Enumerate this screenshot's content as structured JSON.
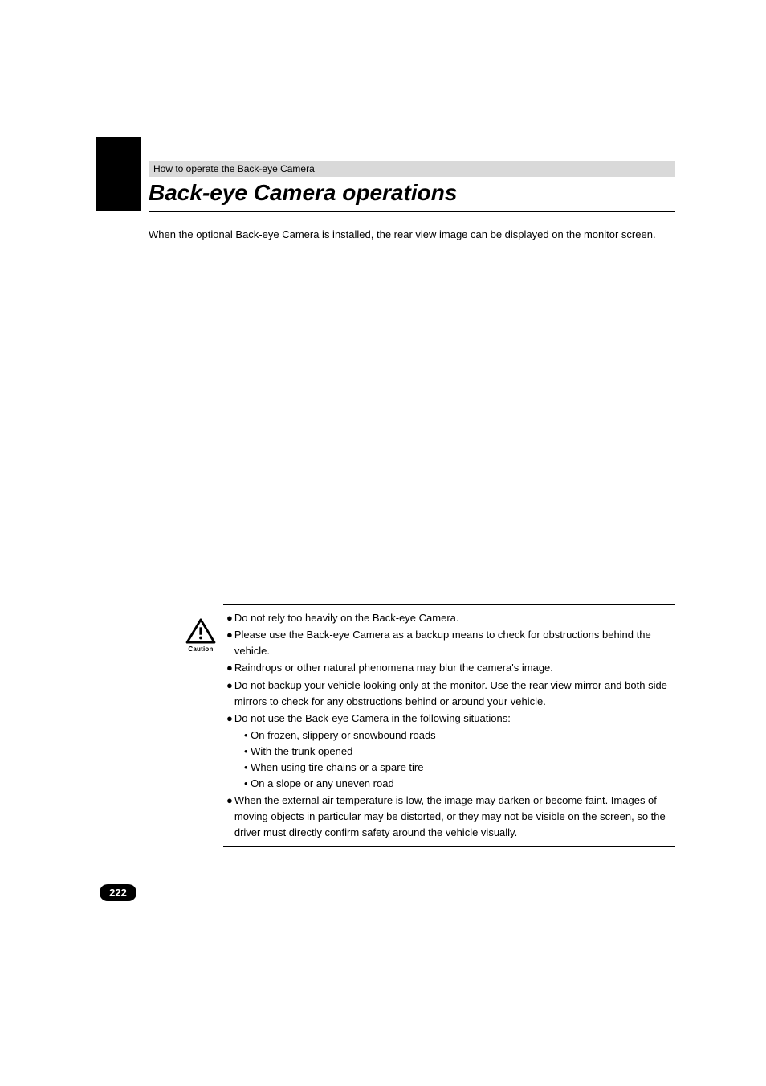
{
  "header": {
    "section_label": "How to operate the Back-eye Camera",
    "title": "Back-eye Camera operations"
  },
  "intro": "When the optional Back-eye Camera is installed, the rear view image can be displayed on the monitor screen.",
  "caution": {
    "label": "Caution",
    "items": [
      {
        "text": "Do not rely too heavily on the Back-eye Camera."
      },
      {
        "text": "Please use the Back-eye Camera as a backup means to check for obstructions behind the vehicle."
      },
      {
        "text": "Raindrops or other natural phenomena may blur the camera's image."
      },
      {
        "text": "Do not backup your vehicle looking only at the monitor. Use the rear view mirror and both side mirrors to check for any obstructions behind or around your vehicle."
      },
      {
        "text": "Do not use the Back-eye Camera in the following situations:",
        "sub": [
          "• On frozen, slippery or snowbound roads",
          "• With the trunk opened",
          "• When using tire chains or a spare tire",
          "• On a slope or any uneven road"
        ]
      },
      {
        "text": "When the external air temperature is low, the image may darken or become faint. Images of moving objects in particular may be distorted, or they may not be visible on the screen, so the driver must directly confirm safety around the vehicle visually."
      }
    ]
  },
  "page_number": "222"
}
